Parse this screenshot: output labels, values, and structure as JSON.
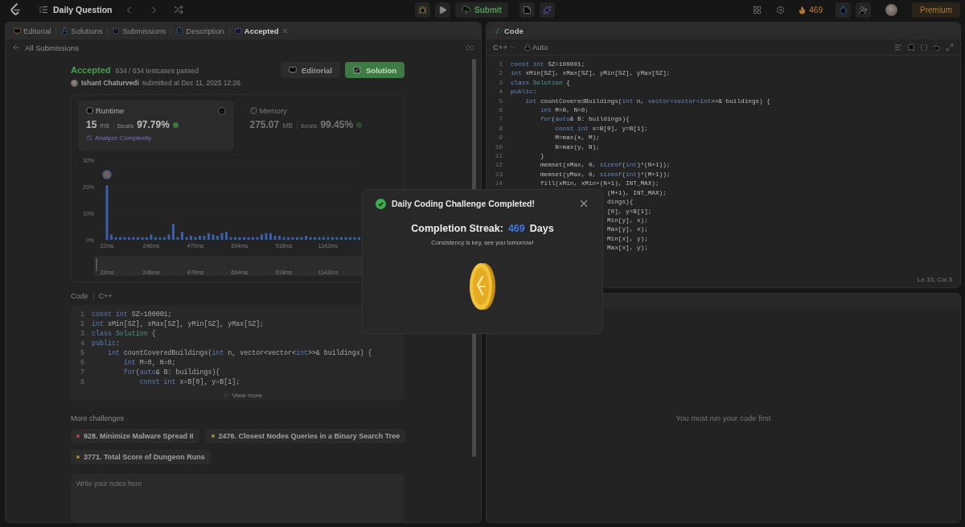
{
  "top_bar": {
    "title": "Daily Question",
    "submit": "Submit",
    "streak": "469",
    "premium": "Premium"
  },
  "left_panel": {
    "tabs": [
      {
        "kind": "editorial",
        "label": "Editorial",
        "selected": false,
        "closable": false
      },
      {
        "kind": "solutions",
        "label": "Solutions",
        "selected": false,
        "closable": false
      },
      {
        "kind": "submissions",
        "label": "Submissions",
        "selected": false,
        "closable": false
      },
      {
        "kind": "description",
        "label": "Description",
        "selected": false,
        "closable": false
      },
      {
        "kind": "accepted",
        "label": "Accepted",
        "selected": true,
        "closable": true
      }
    ],
    "back_link": "All Submissions",
    "submission": {
      "status": "Accepted",
      "testcases": "634 / 634 testcases passed",
      "author": "Ishant Chaturvedi",
      "submitted": "submitted at Dec 11, 2025 12:26",
      "buttons": [
        {
          "kind": "editorial",
          "label": "Editorial"
        },
        {
          "kind": "solution",
          "label": "Solution"
        }
      ]
    },
    "stats": [
      {
        "kind": "runtime",
        "label": "Runtime",
        "value": "15",
        "unit": "ms",
        "beats_label": "Beats",
        "percent": "97.79%",
        "selected": true,
        "link": "Analyze Complexity"
      },
      {
        "kind": "memory",
        "label": "Memory",
        "value": "275.07",
        "unit": "MB",
        "beats_label": "Beats",
        "percent": "99.45%",
        "selected": false
      }
    ],
    "chart_data": {
      "type": "bar",
      "xlim": [
        0,
        1300
      ],
      "ylim": [
        0,
        30
      ],
      "yticks": [
        {
          "value": 0,
          "label": "0%"
        },
        {
          "value": 10,
          "label": "10%"
        },
        {
          "value": 20,
          "label": "20%"
        },
        {
          "value": 30,
          "label": "30%"
        }
      ],
      "xticks": [
        {
          "value": 22,
          "label": "22ms"
        },
        {
          "value": 246,
          "label": "246ms"
        },
        {
          "value": 470,
          "label": "470ms"
        },
        {
          "value": 694,
          "label": "694ms"
        },
        {
          "value": 918,
          "label": "918ms"
        },
        {
          "value": 1142,
          "label": "1142ms"
        }
      ],
      "x": [
        22,
        44.4,
        66.8,
        89.2,
        111.6,
        134,
        156.4,
        178.8,
        201.2,
        223.6,
        246,
        268.4,
        290.8,
        313.2,
        335.6,
        358,
        380.4,
        402.8,
        425.2,
        447.6,
        470,
        492.4,
        514.8,
        537.2,
        559.6,
        582,
        604.4,
        626.8,
        649.2,
        671.6,
        694,
        716.4,
        738.8,
        761.2,
        783.6,
        806,
        828.4,
        850.8,
        873.2,
        895.6,
        918,
        940.4,
        962.8,
        985.2,
        1007.6,
        1030,
        1052.4,
        1074.8,
        1097.2,
        1119.6,
        1142,
        1164.4,
        1186.8,
        1209.2,
        1231.6,
        1254,
        1276.4,
        1298.8
      ],
      "series": [
        {
          "color": "#3b5fa8",
          "values": [
            20.5,
            2,
            1,
            1,
            1,
            1,
            1,
            1,
            1,
            1,
            2,
            1,
            1,
            1,
            2,
            6,
            1,
            3,
            1,
            1.5,
            1,
            1.5,
            1.5,
            2.5,
            2,
            1.5,
            2.5,
            3,
            1,
            1,
            1,
            1,
            1,
            1,
            1,
            2,
            2.5,
            2.5,
            1.5,
            1.5,
            1,
            1,
            1,
            1,
            1,
            1.5,
            1,
            1,
            1,
            1,
            1,
            1,
            1,
            1,
            1,
            1,
            1,
            1
          ]
        }
      ]
    },
    "range": {
      "level": 1,
      "labels": [
        "22ms",
        "246ms",
        "470ms",
        "694ms",
        "918ms",
        "1142ms"
      ]
    },
    "code_header": {
      "label": "Code",
      "language": "C++"
    },
    "code": [
      {
        "n": "1",
        "t": [
          {
            "text": "const int",
            "kind": "kw"
          },
          {
            "text": " SZ=100001;",
            "kind": "p"
          }
        ]
      },
      {
        "n": "2",
        "t": [
          {
            "text": "int",
            "kind": "kw"
          },
          {
            "text": " xMin[SZ], xMax[SZ], yMin[SZ], yMax[SZ];",
            "kind": "p"
          }
        ]
      },
      {
        "n": "3",
        "t": [
          {
            "text": "class",
            "kind": "kw"
          },
          {
            "text": " Solution",
            "kind": "type"
          },
          {
            "text": " {",
            "kind": "p"
          }
        ]
      },
      {
        "n": "4",
        "t": [
          {
            "text": "public",
            "kind": "kw"
          },
          {
            "text": ":",
            "kind": "p"
          }
        ]
      },
      {
        "n": "5",
        "t": [
          {
            "text": "    int",
            "kind": "kw"
          },
          {
            "text": " countCoveredBuildings(",
            "kind": "p"
          },
          {
            "text": "int",
            "kind": "kw"
          },
          {
            "text": " n, vector<vector<",
            "kind": "p"
          },
          {
            "text": "int",
            "kind": "kw"
          },
          {
            "text": ">>& buildings) {",
            "kind": "p"
          }
        ]
      },
      {
        "n": "6",
        "t": [
          {
            "text": "        int",
            "kind": "kw"
          },
          {
            "text": " M=0, N=0;",
            "kind": "p"
          }
        ]
      },
      {
        "n": "7",
        "t": [
          {
            "text": "        for",
            "kind": "kw"
          },
          {
            "text": "(",
            "kind": "p"
          },
          {
            "text": "auto",
            "kind": "kw"
          },
          {
            "text": "& B: buildings){",
            "kind": "p"
          }
        ]
      },
      {
        "n": "8",
        "t": [
          {
            "text": "            const int",
            "kind": "kw"
          },
          {
            "text": " x=B[0], y=B[1];",
            "kind": "p"
          }
        ]
      }
    ],
    "view_more": "View more",
    "more_title": "More challenges",
    "challenges": [
      {
        "title": "928. Minimize Malware Spread II",
        "color": "#c2404a"
      },
      {
        "title": "2476. Closest Nodes Queries in a Binary Search Tree",
        "color": "#a08a2e"
      },
      {
        "title": "3771. Total Score of Dungeon Runs",
        "color": "#a08a2e"
      }
    ],
    "notes": {
      "placeholder": "Write your notes here"
    }
  },
  "editor": {
    "title": "Code",
    "language": "C++",
    "mode": "Auto",
    "status": "Ln 33, Col 3",
    "lines": [
      {
        "n": "1",
        "t": [
          {
            "text": "const int",
            "kind": "kw"
          },
          {
            "text": " SZ=100001;",
            "kind": "p"
          }
        ]
      },
      {
        "n": "2",
        "t": [
          {
            "text": "int",
            "kind": "kw"
          },
          {
            "text": " xMin[SZ], xMax[SZ], yMin[SZ], yMax[SZ];",
            "kind": "p"
          }
        ]
      },
      {
        "n": "3",
        "t": [
          {
            "text": "class",
            "kind": "kw"
          },
          {
            "text": " Solution",
            "kind": "type"
          },
          {
            "text": " {",
            "kind": "p"
          }
        ]
      },
      {
        "n": "4",
        "t": [
          {
            "text": "public",
            "kind": "kw"
          },
          {
            "text": ":",
            "kind": "p"
          }
        ]
      },
      {
        "n": "5",
        "t": [
          {
            "text": "    int",
            "kind": "kw"
          },
          {
            "text": " countCoveredBuildings(",
            "kind": "p"
          },
          {
            "text": "int",
            "kind": "kw"
          },
          {
            "text": " n, ",
            "kind": "p"
          },
          {
            "text": "vector<vector<int",
            "kind": "kw"
          },
          {
            "text": ">>& buildings) {",
            "kind": "p"
          }
        ]
      },
      {
        "n": "6",
        "t": [
          {
            "text": "        int",
            "kind": "kw"
          },
          {
            "text": " M=0, N=0;",
            "kind": "p"
          }
        ]
      },
      {
        "n": "7",
        "t": [
          {
            "text": "        for",
            "kind": "kw"
          },
          {
            "text": "(",
            "kind": "p"
          },
          {
            "text": "auto",
            "kind": "kw"
          },
          {
            "text": "& B: buildings){",
            "kind": "p"
          }
        ]
      },
      {
        "n": "8",
        "t": [
          {
            "text": "            const int",
            "kind": "kw"
          },
          {
            "text": " x=B[0], y=B[1];",
            "kind": "p"
          }
        ]
      },
      {
        "n": "9",
        "t": [
          {
            "text": "            M=max(x, M);",
            "kind": "p"
          }
        ]
      },
      {
        "n": "10",
        "t": [
          {
            "text": "            N=max(y, N);",
            "kind": "p"
          }
        ]
      },
      {
        "n": "11",
        "t": [
          {
            "text": "        }",
            "kind": "p"
          }
        ]
      },
      {
        "n": "12",
        "t": [
          {
            "text": "        memset(xMax, 0, ",
            "kind": "p"
          },
          {
            "text": "sizeof",
            "kind": "kw"
          },
          {
            "text": "(",
            "kind": "p"
          },
          {
            "text": "int",
            "kind": "kw"
          },
          {
            "text": ")*(N+1));",
            "kind": "p"
          }
        ]
      },
      {
        "n": "13",
        "t": [
          {
            "text": "        memset(yMax, 0, ",
            "kind": "p"
          },
          {
            "text": "sizeof",
            "kind": "kw"
          },
          {
            "text": "(",
            "kind": "p"
          },
          {
            "text": "int",
            "kind": "kw"
          },
          {
            "text": ")*(M+1));",
            "kind": "p"
          }
        ]
      },
      {
        "n": "14",
        "t": [
          {
            "text": "        fill(xMin, xMin+(N+1), INT_MAX);",
            "kind": "p"
          }
        ]
      },
      {
        "partial": true,
        "t": [
          {
            "text": "(M+1), INT_MAX);",
            "kind": "p"
          }
        ]
      },
      {
        "partial": true,
        "t": [
          {
            "text": "dings){",
            "kind": "p"
          }
        ]
      },
      {
        "partial": true,
        "t": [
          {
            "text": "[0], y=B[1];",
            "kind": "p"
          }
        ]
      },
      {
        "partial": true,
        "t": [
          {
            "text": "Min[y], x);",
            "kind": "p"
          }
        ]
      },
      {
        "partial": true,
        "t": [
          {
            "text": "Max[y], x);",
            "kind": "p"
          }
        ]
      },
      {
        "partial": true,
        "t": [
          {
            "text": "Min[x], y);",
            "kind": "p"
          }
        ]
      },
      {
        "partial": true,
        "t": [
          {
            "text": "Max[x], y);",
            "kind": "p"
          }
        ]
      }
    ]
  },
  "result_panel": {
    "message": "You must run your code first"
  },
  "modal": {
    "title": "Daily Coding Challenge Completed!",
    "streak_label": "Completion Streak:",
    "streak_value": "469",
    "streak_unit": "Days",
    "message": "Consistency is key, see you tomorrow!"
  }
}
